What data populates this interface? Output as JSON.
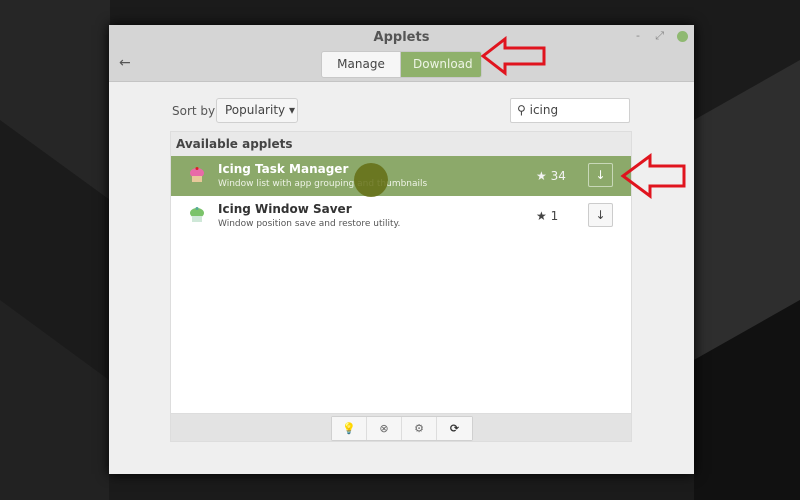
{
  "window": {
    "title": "Applets",
    "minimize": "-",
    "maximize": "⤢",
    "back": "←"
  },
  "tabs": [
    {
      "label": "Manage",
      "active": false
    },
    {
      "label": "Download",
      "active": true
    }
  ],
  "sort": {
    "label": "Sort by",
    "value": "Popularity ▾"
  },
  "search": {
    "icon": "search-icon",
    "value": "icing"
  },
  "list": {
    "header": "Available applets",
    "items": [
      {
        "name": "Icing Task Manager",
        "description": "Window list with app grouping and thumbnails",
        "stars": "★ 34",
        "selected": true,
        "icon_color": "#e86aa8"
      },
      {
        "name": "Icing Window Saver",
        "description": "Window position save and restore utility.",
        "stars": "★ 1",
        "selected": false,
        "icon_color": "#7bc36a"
      }
    ]
  },
  "toolbar": [
    {
      "icon": "lightbulb-icon",
      "glyph": "💡"
    },
    {
      "icon": "remove-icon",
      "glyph": "⊗"
    },
    {
      "icon": "gear-icon",
      "glyph": "⚙"
    },
    {
      "icon": "refresh-icon",
      "glyph": "⟳"
    }
  ],
  "colors": {
    "accent": "#8fb16b",
    "annotation": "#e0141e"
  }
}
